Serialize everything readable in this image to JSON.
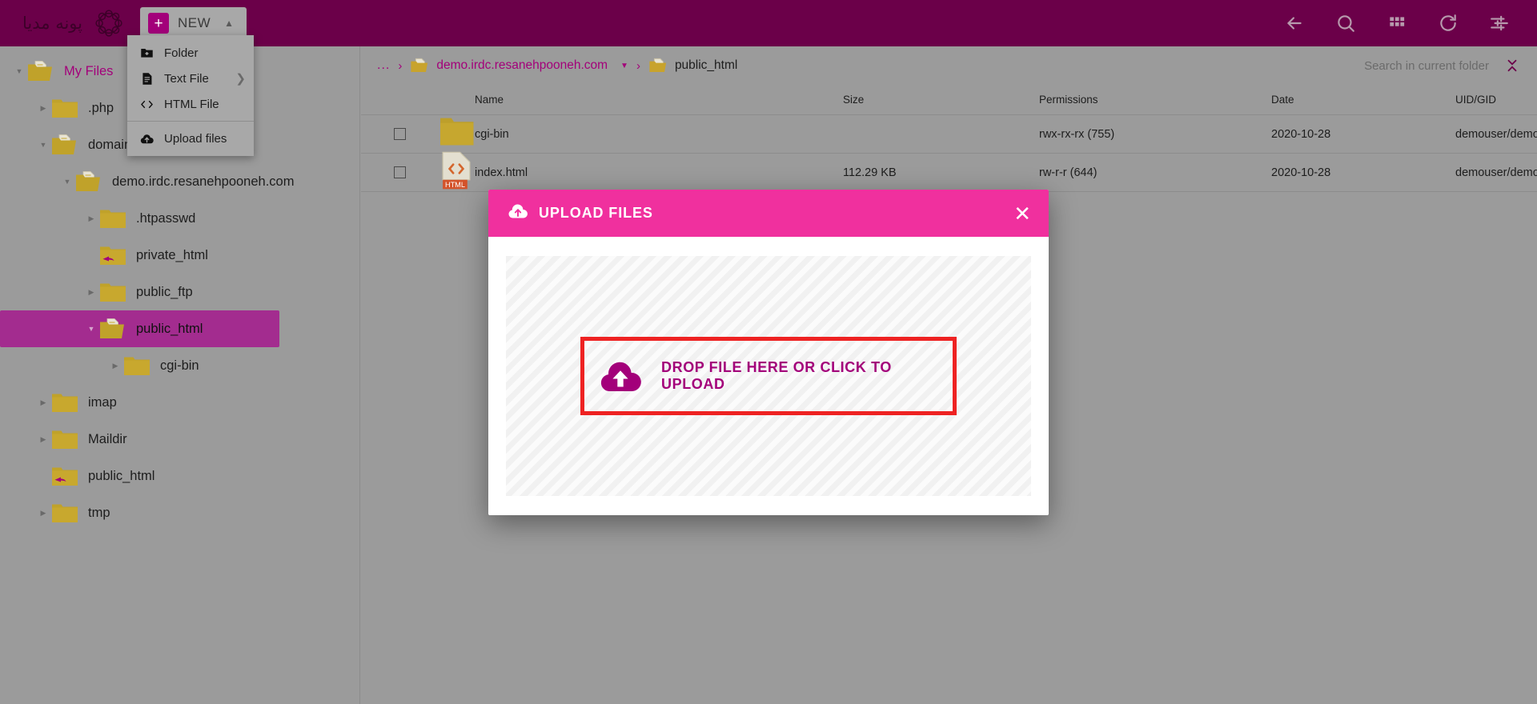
{
  "topbar": {
    "logo_text": "پونه مدیا",
    "logo_icon": "ring-logo-icon",
    "new_button": {
      "label": "NEW",
      "plus_icon": "plus-icon",
      "caret_icon": "caret-up-icon"
    },
    "icons": [
      {
        "name": "back-arrow-icon",
        "title": "Back"
      },
      {
        "name": "search-icon",
        "title": "Search"
      },
      {
        "name": "grid-view-icon",
        "title": "Grid view"
      },
      {
        "name": "refresh-icon",
        "title": "Refresh"
      },
      {
        "name": "settings-sliders-icon",
        "title": "Settings"
      }
    ]
  },
  "new_menu": {
    "items": [
      {
        "label": "Folder",
        "icon": "folder-add-icon",
        "submenu": false
      },
      {
        "label": "Text File",
        "icon": "text-file-icon",
        "submenu": true,
        "submenu_icon": "chevron-right-icon"
      },
      {
        "label": "HTML File",
        "icon": "code-brackets-icon",
        "submenu": false
      }
    ],
    "footer_items": [
      {
        "label": "Upload files",
        "icon": "cloud-upload-icon",
        "submenu": false
      }
    ]
  },
  "sidebar": {
    "items": [
      {
        "label": "My Files",
        "indent": 0,
        "twisty": "down",
        "icon": "folder-open-doc",
        "selected": false,
        "root": true
      },
      {
        "label": ".php",
        "indent": 1,
        "twisty": "right",
        "icon": "folder",
        "selected": false,
        "root": false
      },
      {
        "label": "domains",
        "indent": 1,
        "twisty": "down",
        "icon": "folder-open-doc",
        "selected": false,
        "root": false
      },
      {
        "label": "demo.irdc.resanehpooneh.com",
        "indent": 2,
        "twisty": "down",
        "icon": "folder-open-doc",
        "selected": false,
        "root": false
      },
      {
        "label": ".htpasswd",
        "indent": 3,
        "twisty": "right",
        "icon": "folder",
        "selected": false,
        "root": false
      },
      {
        "label": "private_html",
        "indent": 3,
        "twisty": "none",
        "icon": "folder-link",
        "selected": false,
        "root": false
      },
      {
        "label": "public_ftp",
        "indent": 3,
        "twisty": "right",
        "icon": "folder",
        "selected": false,
        "root": false
      },
      {
        "label": "public_html",
        "indent": 3,
        "twisty": "down",
        "icon": "folder-open-doc",
        "selected": true,
        "root": false
      },
      {
        "label": "cgi-bin",
        "indent": 4,
        "twisty": "right",
        "icon": "folder",
        "selected": false,
        "root": false
      },
      {
        "label": "imap",
        "indent": 1,
        "twisty": "right",
        "icon": "folder",
        "selected": false,
        "root": false
      },
      {
        "label": "Maildir",
        "indent": 1,
        "twisty": "right",
        "icon": "folder",
        "selected": false,
        "root": false
      },
      {
        "label": "public_html",
        "indent": 1,
        "twisty": "none",
        "icon": "folder-link",
        "selected": false,
        "root": false
      },
      {
        "label": "tmp",
        "indent": 1,
        "twisty": "right",
        "icon": "folder",
        "selected": false,
        "root": false
      }
    ]
  },
  "breadcrumb": {
    "ellipsis": "...",
    "separator": "›",
    "items": [
      {
        "label": "demo.irdc.resanehpooneh.com",
        "icon": "folder-doc-icon",
        "has_caret": true,
        "last": false
      },
      {
        "label": "public_html",
        "icon": "folder-doc-icon",
        "has_caret": false,
        "last": true
      }
    ]
  },
  "search": {
    "placeholder": "Search in current folder",
    "value": "",
    "collapse_icon": "collapse-vertical-icon"
  },
  "file_table": {
    "columns": [
      "Name",
      "Size",
      "Permissions",
      "Date",
      "UID/GID"
    ],
    "rows": [
      {
        "name": "cgi-bin",
        "size": "",
        "permissions": "rwx-rx-rx (755)",
        "date": "2020-10-28",
        "uidgid": "demouser/demouser",
        "icon": "folder-icon",
        "checked": false
      },
      {
        "name": "index.html",
        "size": "112.29 KB",
        "permissions": "rw-r-r (644)",
        "date": "2020-10-28",
        "uidgid": "demouser/demouser",
        "icon": "html-file-icon",
        "checked": false
      }
    ]
  },
  "upload_modal": {
    "title": "UPLOAD FILES",
    "title_icon": "cloud-upload-icon",
    "close_icon": "close-x-icon",
    "dropzone_text": "DROP FILE HERE OR CLICK TO UPLOAD",
    "dropzone_icon": "cloud-upload-icon",
    "highlight_color": "#ee2222",
    "accent_color": "#a3007a",
    "header_color": "#f0309e"
  }
}
